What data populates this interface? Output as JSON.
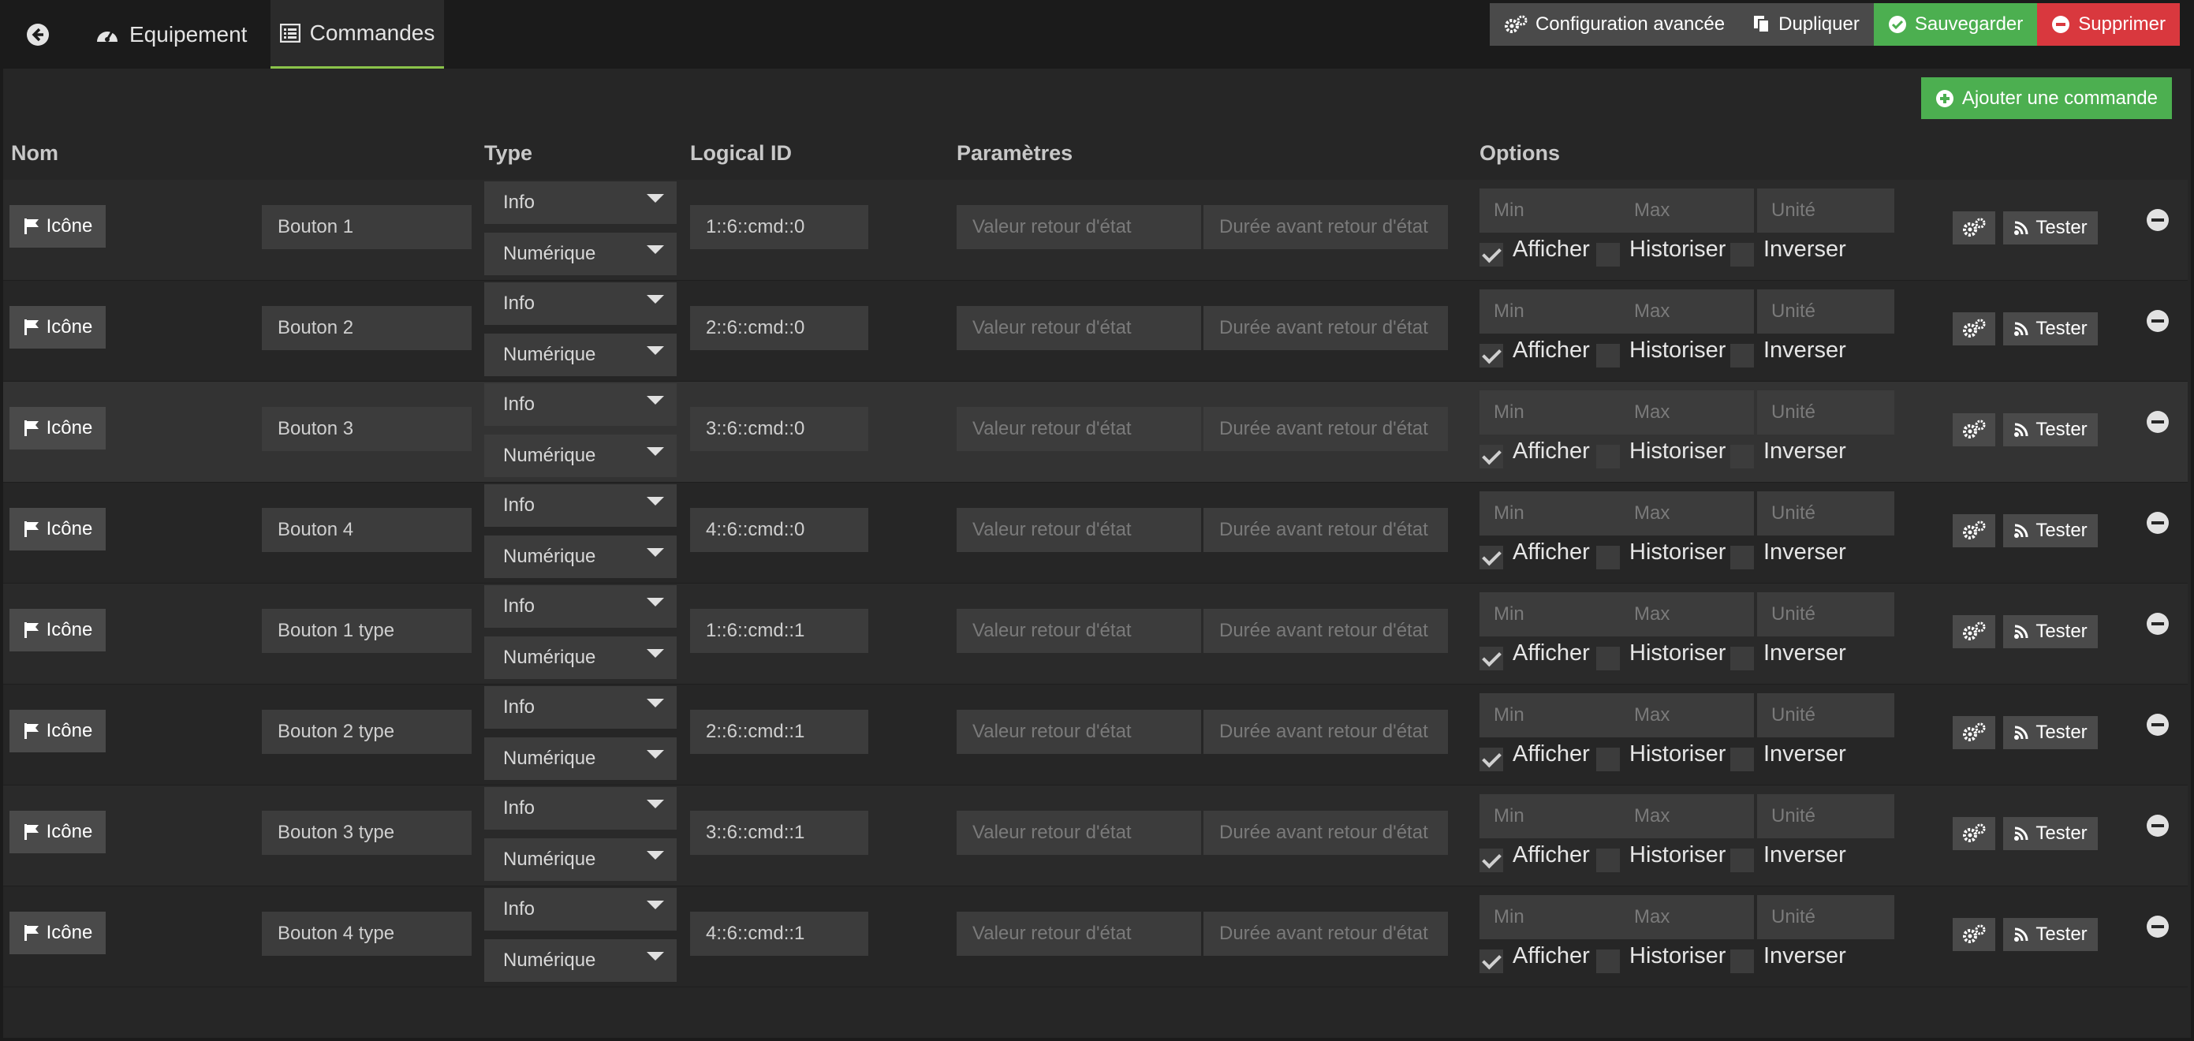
{
  "tabs": {
    "back_icon": "arrow-circle-left-icon",
    "equipement": "Equipement",
    "commandes": "Commandes"
  },
  "actions": {
    "config": "Configuration avancée",
    "dupliquer": "Dupliquer",
    "sauvegarder": "Sauvegarder",
    "supprimer": "Supprimer",
    "ajouter": "Ajouter une commande"
  },
  "columns": {
    "nom": "Nom",
    "type": "Type",
    "logical_id": "Logical ID",
    "parametres": "Paramètres",
    "options": "Options"
  },
  "colors": {
    "accent": "#8bc34a",
    "success": "#4caf50",
    "danger": "#d9383e",
    "button": "#4a4a4a"
  },
  "row_labels": {
    "icone": "Icône",
    "valeur_placeholder": "Valeur retour d'état",
    "duree_placeholder": "Durée avant retour d'état",
    "min_placeholder": "Min",
    "max_placeholder": "Max",
    "unite_placeholder": "Unité",
    "afficher": "Afficher",
    "historiser": "Historiser",
    "inverser": "Inverser",
    "tester": "Tester"
  },
  "commands": [
    {
      "name": "Bouton 1",
      "type": "Info",
      "subtype": "Numérique",
      "logical_id": "1::6::cmd::0",
      "afficher": true,
      "historiser": false,
      "inverser": false
    },
    {
      "name": "Bouton 2",
      "type": "Info",
      "subtype": "Numérique",
      "logical_id": "2::6::cmd::0",
      "afficher": true,
      "historiser": false,
      "inverser": false
    },
    {
      "name": "Bouton 3",
      "type": "Info",
      "subtype": "Numérique",
      "logical_id": "3::6::cmd::0",
      "afficher": true,
      "historiser": false,
      "inverser": false
    },
    {
      "name": "Bouton 4",
      "type": "Info",
      "subtype": "Numérique",
      "logical_id": "4::6::cmd::0",
      "afficher": true,
      "historiser": false,
      "inverser": false
    },
    {
      "name": "Bouton 1 type",
      "type": "Info",
      "subtype": "Numérique",
      "logical_id": "1::6::cmd::1",
      "afficher": true,
      "historiser": false,
      "inverser": false
    },
    {
      "name": "Bouton 2 type",
      "type": "Info",
      "subtype": "Numérique",
      "logical_id": "2::6::cmd::1",
      "afficher": true,
      "historiser": false,
      "inverser": false
    },
    {
      "name": "Bouton 3 type",
      "type": "Info",
      "subtype": "Numérique",
      "logical_id": "3::6::cmd::1",
      "afficher": true,
      "historiser": false,
      "inverser": false
    },
    {
      "name": "Bouton 4 type",
      "type": "Info",
      "subtype": "Numérique",
      "logical_id": "4::6::cmd::1",
      "afficher": true,
      "historiser": false,
      "inverser": false
    }
  ]
}
